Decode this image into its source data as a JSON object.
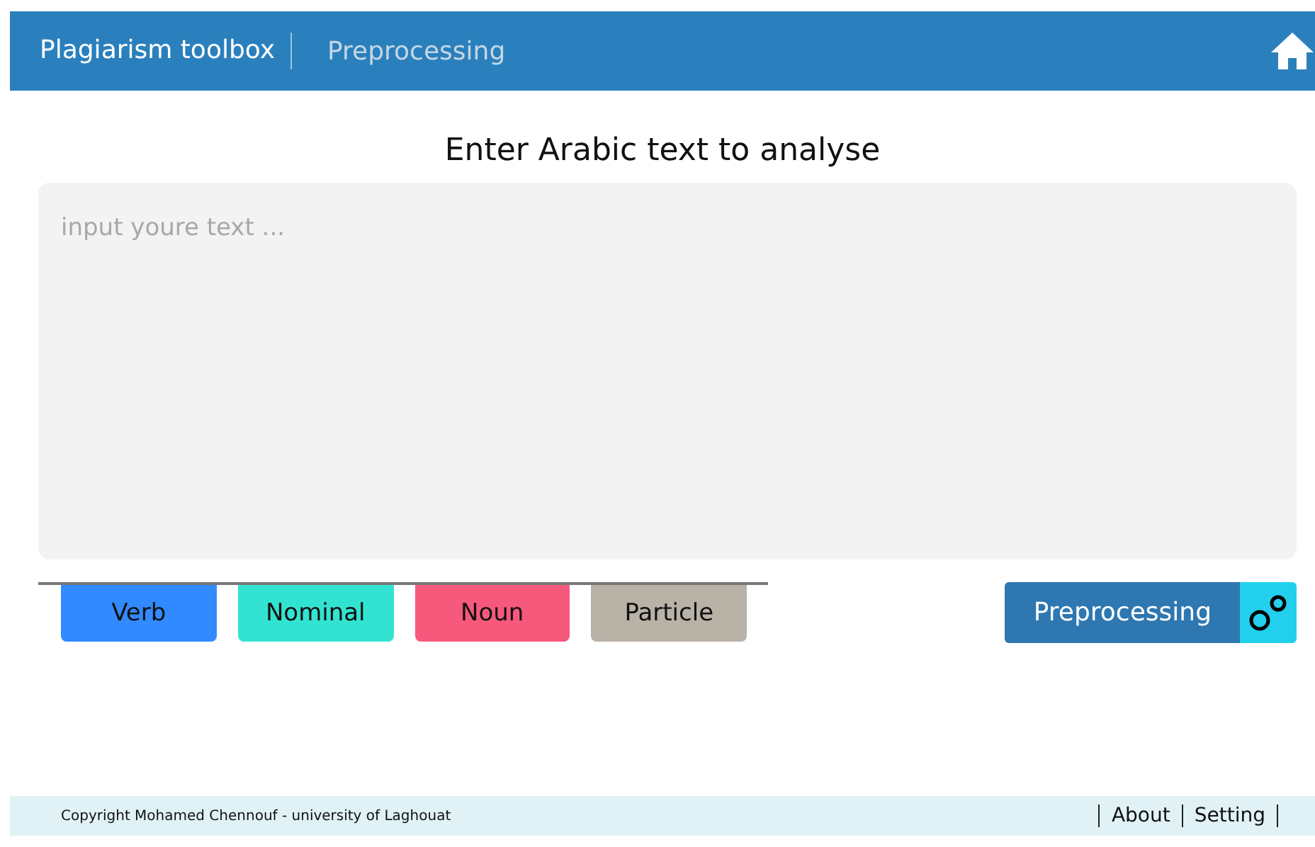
{
  "header": {
    "brand": "Plagiarism toolbox",
    "section": "Preprocessing"
  },
  "heading": "Enter Arabic text to analyse",
  "text_input": {
    "placeholder": "input youre text ..."
  },
  "tags": [
    {
      "label": "Verb",
      "color": "#318aff"
    },
    {
      "label": "Nominal",
      "color": "#32e3d1"
    },
    {
      "label": "Noun",
      "color": "#f6597c"
    },
    {
      "label": "Particle",
      "color": "#b9b2a7"
    }
  ],
  "action_button": {
    "label": "Preprocessing"
  },
  "footer": {
    "copyright": "Copyright Mohamed Chennouf - university of Laghouat",
    "links": [
      "About",
      "Setting"
    ]
  }
}
